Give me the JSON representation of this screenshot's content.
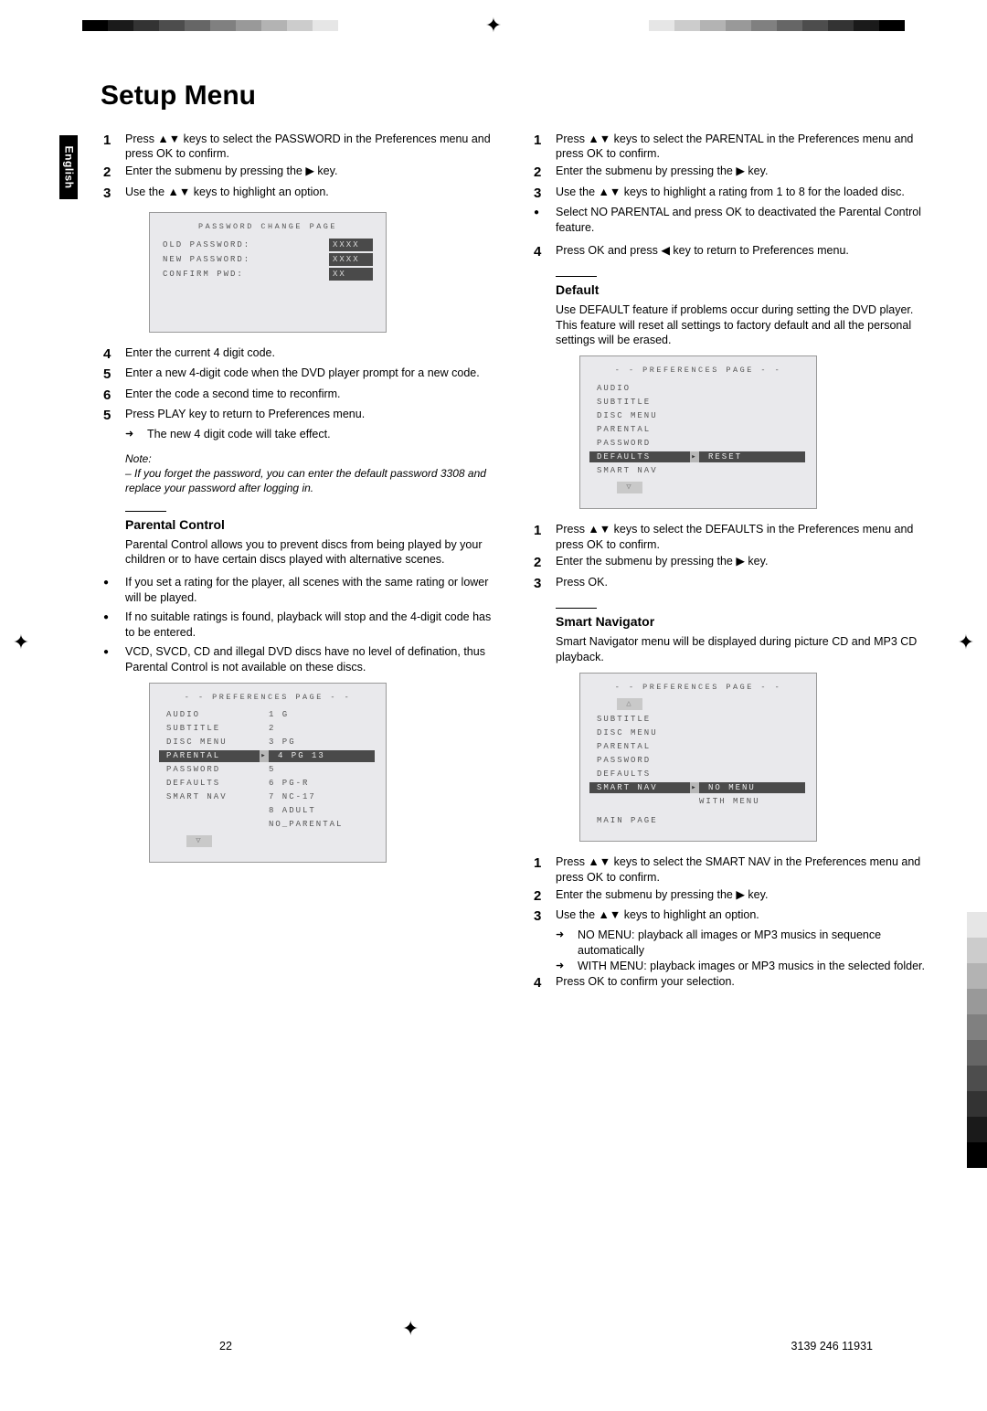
{
  "title": "Setup Menu",
  "language_tab": "English",
  "page_number": "22",
  "part_number": "3139 246 11931",
  "col1": {
    "password_steps_a": [
      {
        "n": "1",
        "t": "Press ▲▼ keys to select the PASSWORD in the Preferences menu and press OK to confirm."
      },
      {
        "n": "2",
        "t": "Enter the submenu by pressing the ▶ key."
      },
      {
        "n": "3",
        "t": "Use the ▲▼ keys to highlight an option."
      }
    ],
    "password_osd": {
      "title": "PASSWORD CHANGE PAGE",
      "rows": [
        {
          "label": "OLD PASSWORD:",
          "value": "XXXX"
        },
        {
          "label": "NEW PASSWORD:",
          "value": "XXXX"
        },
        {
          "label": "CONFIRM PWD:",
          "value": "XX"
        }
      ]
    },
    "password_steps_b": [
      {
        "n": "4",
        "t": "Enter the current 4 digit code."
      },
      {
        "n": "5",
        "t": "Enter a new 4-digit code when the DVD player prompt for a new code."
      },
      {
        "n": "6",
        "t": "Enter the code a second time to reconfirm."
      },
      {
        "n": "5",
        "t": "Press PLAY key to return to Preferences menu."
      }
    ],
    "password_result": "The new 4 digit code will take effect.",
    "note_label": "Note:",
    "note_text": "– If you forget the password, you can enter the default password 3308 and replace your password after logging in.",
    "parental_heading": "Parental Control",
    "parental_intro": "Parental Control allows you to prevent discs from being played by your children or to have certain discs played with alternative scenes.",
    "parental_bullets": [
      "If you set a rating for the player, all scenes with the same rating or lower will be played.",
      "If no suitable ratings is found, playback will stop and the 4-digit code has to be entered.",
      "VCD, SVCD, CD and illegal DVD discs have no level of defination, thus Parental Control is not available on these discs."
    ],
    "parental_osd": {
      "title": "- - PREFERENCES PAGE - -",
      "left": [
        "AUDIO",
        "SUBTITLE",
        "DISC MENU",
        "PARENTAL",
        "PASSWORD",
        "DEFAULTS",
        "SMART NAV"
      ],
      "selected": "PARENTAL",
      "right": [
        {
          "n": "1",
          "label": "G"
        },
        {
          "n": "2",
          "label": ""
        },
        {
          "n": "3",
          "label": "PG"
        },
        {
          "n": "4",
          "label": "PG 13",
          "sel": true
        },
        {
          "n": "5",
          "label": ""
        },
        {
          "n": "6",
          "label": "PG-R"
        },
        {
          "n": "7",
          "label": "NC-17"
        },
        {
          "n": "8",
          "label": "ADULT"
        },
        {
          "n": "",
          "label": "NO_PARENTAL"
        }
      ]
    }
  },
  "col2": {
    "parental_steps": [
      {
        "n": "1",
        "t": "Press ▲▼ keys to select the PARENTAL in the Preferences menu and press OK to confirm."
      },
      {
        "n": "2",
        "t": "Enter the submenu by pressing the ▶ key."
      },
      {
        "n": "3",
        "t": "Use the ▲▼ keys to highlight a rating from 1 to 8 for the loaded disc."
      }
    ],
    "parental_bullet": "Select NO PARENTAL and press OK to deactivated the Parental Control feature.",
    "parental_step4": {
      "n": "4",
      "t": "Press OK and press ◀ key to return to Preferences menu."
    },
    "default_heading": "Default",
    "default_intro": "Use DEFAULT feature if problems occur during setting the DVD player. This feature will reset all settings to factory default and all the personal settings will be erased.",
    "default_osd": {
      "title": "- - PREFERENCES PAGE - -",
      "left": [
        "AUDIO",
        "SUBTITLE",
        "DISC MENU",
        "PARENTAL",
        "PASSWORD",
        "DEFAULTS",
        "SMART NAV"
      ],
      "selected": "DEFAULTS",
      "right_selected": "RESET"
    },
    "default_steps": [
      {
        "n": "1",
        "t": "Press ▲▼ keys to select the DEFAULTS in the Preferences menu and press OK to confirm."
      },
      {
        "n": "2",
        "t": "Enter the submenu by pressing the ▶ key."
      },
      {
        "n": "3",
        "t": "Press OK."
      }
    ],
    "smart_heading": "Smart Navigator",
    "smart_intro": "Smart Navigator menu will be displayed during picture CD and MP3 CD playback.",
    "smart_osd": {
      "title": "- - PREFERENCES PAGE - -",
      "left": [
        "SUBTITLE",
        "DISC MENU",
        "PARENTAL",
        "PASSWORD",
        "DEFAULTS",
        "SMART NAV"
      ],
      "selected": "SMART NAV",
      "right": [
        "NO MENU",
        "WITH MENU"
      ],
      "right_selected": "NO MENU",
      "main_page": "MAIN PAGE"
    },
    "smart_steps": [
      {
        "n": "1",
        "t": "Press ▲▼ keys to select the SMART NAV in the Preferences menu and press OK to confirm."
      },
      {
        "n": "2",
        "t": "Enter the submenu by pressing the ▶ key."
      },
      {
        "n": "3",
        "t": "Use the ▲▼ keys to highlight an option."
      }
    ],
    "smart_opts": [
      "NO MENU: playback all images or MP3 musics in sequence automatically",
      "WITH MENU: playback images or MP3 musics in the selected folder."
    ],
    "smart_step4": {
      "n": "4",
      "t": "Press OK to confirm your selection."
    }
  }
}
